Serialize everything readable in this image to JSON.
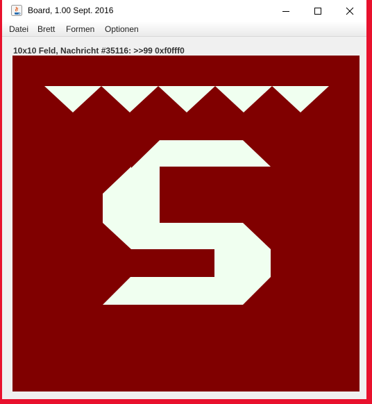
{
  "window": {
    "title": "Board, 1.00 Sept. 2016",
    "app_icon": "java-icon",
    "controls": [
      "minimize-icon",
      "maximize-icon",
      "close-icon"
    ]
  },
  "menu": {
    "items": [
      "Datei",
      "Brett",
      "Formen",
      "Optionen"
    ]
  },
  "status": {
    "text": "10x10 Feld, Nachricht #35116: >>99 0xf0fff0"
  },
  "board": {
    "background_color": "#800000",
    "shape_color": "#f0fff0",
    "letter": "S",
    "triangle_count": 5
  },
  "colors": {
    "frame_border": "#e8112d",
    "window_background": "#f0f0f0"
  }
}
